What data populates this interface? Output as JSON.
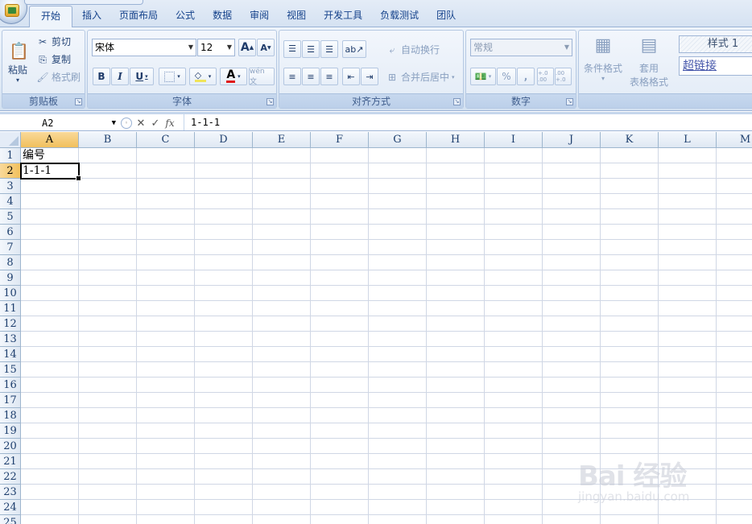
{
  "tabs": [
    "开始",
    "插入",
    "页面布局",
    "公式",
    "数据",
    "审阅",
    "视图",
    "开发工具",
    "负载测试",
    "团队"
  ],
  "active_tab": "开始",
  "clipboard": {
    "paste": "粘贴",
    "cut": "剪切",
    "copy": "复制",
    "format_painter": "格式刷",
    "label": "剪贴板"
  },
  "font": {
    "name": "宋体",
    "size": "12",
    "grow": "A",
    "shrink": "A",
    "bold": "B",
    "italic": "I",
    "underline": "U",
    "color_glyph": "A",
    "phonetic": "wén 文",
    "label": "字体"
  },
  "alignment": {
    "wrap_text": "自动换行",
    "merge_center": "合并后居中",
    "label": "对齐方式"
  },
  "number": {
    "format": "常规",
    "percent": "%",
    "comma": ",",
    "inc_decimal": "+.0 .00",
    "dec_decimal": ".00 +.0",
    "label": "数字"
  },
  "styles": {
    "conditional": "条件格式",
    "table_format_line1": "套用",
    "table_format_line2": "表格格式",
    "style1": "样式 1",
    "hyperlink": "超链接"
  },
  "formula_bar": {
    "name_box": "A2",
    "cancel": "✕",
    "enter": "✓",
    "fx": "fx",
    "formula": "1-1-1"
  },
  "columns": [
    "A",
    "B",
    "C",
    "D",
    "E",
    "F",
    "G",
    "H",
    "I",
    "J",
    "K",
    "L",
    "M"
  ],
  "rows": [
    "1",
    "2",
    "3",
    "4",
    "5",
    "6",
    "7",
    "8",
    "9",
    "10",
    "11",
    "12",
    "13",
    "14",
    "15",
    "16",
    "17",
    "18",
    "19",
    "20",
    "21",
    "22",
    "23",
    "24",
    "25"
  ],
  "cells": {
    "A1": "编号",
    "A2": "1-1-1"
  },
  "selected_cell": "A2",
  "watermark": {
    "brand": "Bai 经验",
    "url": "jingyan.baidu.com"
  }
}
